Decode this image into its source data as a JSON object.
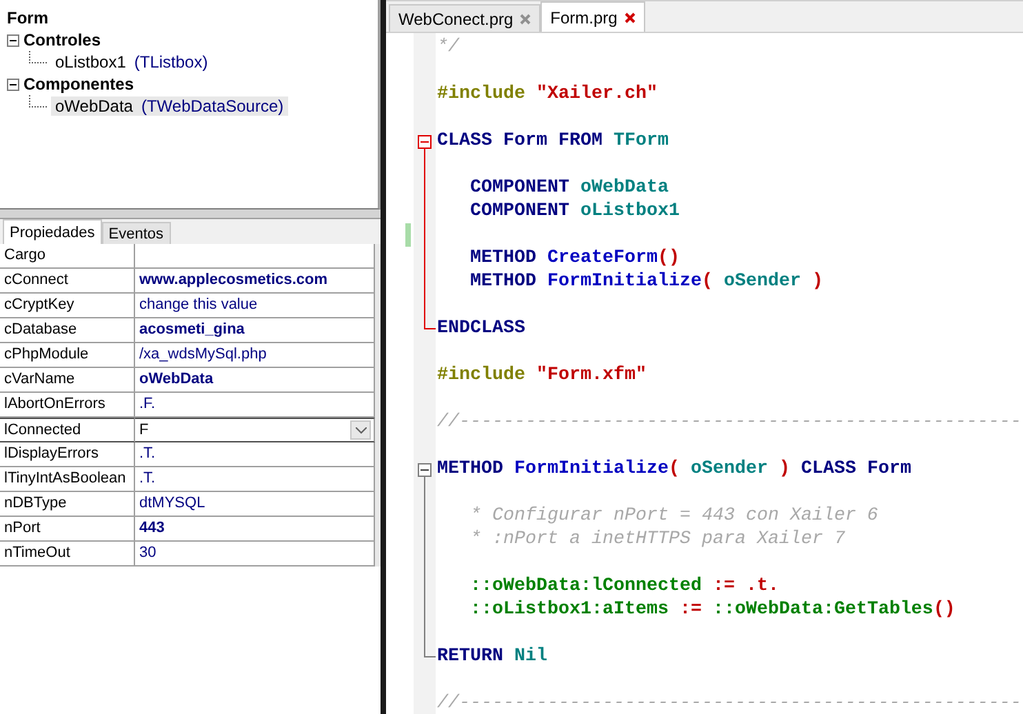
{
  "tree": {
    "root": "Form",
    "groups": [
      {
        "label": "Controles",
        "expanded": true,
        "children": [
          {
            "name": "oListbox1",
            "type": "(TListbox)",
            "selected": false
          }
        ]
      },
      {
        "label": "Componentes",
        "expanded": true,
        "children": [
          {
            "name": "oWebData",
            "type": "(TWebDataSource)",
            "selected": true
          }
        ]
      }
    ]
  },
  "inspector_tabs": [
    {
      "label": "Propiedades",
      "selected": true
    },
    {
      "label": "Eventos",
      "selected": false
    }
  ],
  "properties": [
    {
      "name": "Cargo",
      "bold": false,
      "kind": "text",
      "selected": false
    },
    {
      "name": "cConnect",
      "value": "www.applecosmetics.com",
      "bold": true,
      "kind": "text",
      "selected": false
    },
    {
      "name": "cCryptKey",
      "value": "change this value",
      "bold": false,
      "kind": "text",
      "selected": false
    },
    {
      "name": "cDatabase",
      "value": "acosmeti_gina",
      "bold": true,
      "kind": "text",
      "selected": false
    },
    {
      "name": "cPhpModule",
      "value": "/xa_wdsMySql.php",
      "bold": false,
      "kind": "text",
      "selected": false
    },
    {
      "name": "cVarName",
      "value": "oWebData",
      "bold": true,
      "kind": "text",
      "selected": false
    },
    {
      "name": "lAbortOnErrors",
      "value": ".F.",
      "bold": false,
      "kind": "text",
      "selected": false
    },
    {
      "name": "lConnected",
      "value": "F",
      "bold": false,
      "kind": "dropdown",
      "selected": true
    },
    {
      "name": "lDisplayErrors",
      "value": ".T.",
      "bold": false,
      "kind": "text",
      "selected": false
    },
    {
      "name": "lTinyIntAsBoolean",
      "value": ".T.",
      "bold": false,
      "kind": "text",
      "selected": false
    },
    {
      "name": "nDBType",
      "value": "dtMYSQL",
      "bold": false,
      "kind": "text",
      "selected": false
    },
    {
      "name": "nPort",
      "value": "443",
      "bold": true,
      "kind": "text",
      "selected": false
    },
    {
      "name": "nTimeOut",
      "value": "30",
      "bold": false,
      "kind": "text",
      "selected": false
    }
  ],
  "editor_tabs": [
    {
      "label": "WebConect.prg",
      "selected": false
    },
    {
      "label": "Form.prg",
      "selected": true
    }
  ],
  "code": [
    {
      "kind": "line",
      "tokens": [
        {
          "kind": "comment",
          "text": "*/"
        }
      ]
    },
    {
      "kind": "blank"
    },
    {
      "kind": "line",
      "tokens": [
        {
          "kind": "pre",
          "text": "#include "
        },
        {
          "kind": "str",
          "text": "\"Xailer.ch\""
        }
      ]
    },
    {
      "kind": "blank"
    },
    {
      "kind": "fold",
      "active": true,
      "lines": [
        {
          "kind": "line",
          "tokens": [
            {
              "kind": "kw",
              "text": "CLASS Form FROM "
            },
            {
              "kind": "id",
              "text": "TForm"
            }
          ]
        },
        {
          "kind": "blank"
        },
        {
          "kind": "line",
          "indented": true,
          "tokens": [
            {
              "kind": "kw",
              "text": "COMPONENT "
            },
            {
              "kind": "id",
              "text": "oWebData"
            }
          ]
        },
        {
          "kind": "line",
          "indented": true,
          "tokens": [
            {
              "kind": "kw",
              "text": "COMPONENT "
            },
            {
              "kind": "id",
              "text": "oListbox1"
            }
          ]
        },
        {
          "kind": "blank",
          "changed": true
        },
        {
          "kind": "line",
          "indented": true,
          "tokens": [
            {
              "kind": "kw",
              "text": "METHOD "
            },
            {
              "kind": "fn",
              "text": "CreateForm"
            },
            {
              "kind": "op",
              "text": "()"
            }
          ]
        },
        {
          "kind": "line",
          "indented": true,
          "tokens": [
            {
              "kind": "kw",
              "text": "METHOD "
            },
            {
              "kind": "fn",
              "text": "FormInitialize"
            },
            {
              "kind": "op",
              "text": "( "
            },
            {
              "kind": "id",
              "text": "oSender "
            },
            {
              "kind": "op",
              "text": ")"
            }
          ]
        },
        {
          "kind": "blank"
        },
        {
          "kind": "line",
          "tokens": [
            {
              "kind": "kw",
              "text": "ENDCLASS"
            }
          ]
        }
      ]
    },
    {
      "kind": "blank"
    },
    {
      "kind": "line",
      "tokens": [
        {
          "kind": "pre",
          "text": "#include "
        },
        {
          "kind": "str",
          "text": "\"Form.xfm\""
        }
      ]
    },
    {
      "kind": "blank"
    },
    {
      "kind": "line",
      "tokens": [
        {
          "kind": "comment",
          "text": "//---------------------------------------------------"
        }
      ]
    },
    {
      "kind": "blank"
    },
    {
      "kind": "fold",
      "active": false,
      "lines": [
        {
          "kind": "line",
          "tokens": [
            {
              "kind": "kw",
              "text": "METHOD "
            },
            {
              "kind": "fn",
              "text": "FormInitialize"
            },
            {
              "kind": "op",
              "text": "( "
            },
            {
              "kind": "id",
              "text": "oSender "
            },
            {
              "kind": "op",
              "text": ") "
            },
            {
              "kind": "kw",
              "text": "CLASS Form"
            }
          ]
        },
        {
          "kind": "blank"
        },
        {
          "kind": "line",
          "indented": true,
          "tokens": [
            {
              "kind": "comment",
              "text": "* Configurar nPort = 443 con Xailer 6"
            }
          ]
        },
        {
          "kind": "line",
          "indented": true,
          "tokens": [
            {
              "kind": "comment",
              "text": "* :nPort a inetHTTPS para Xailer 7"
            }
          ]
        },
        {
          "kind": "blank"
        },
        {
          "kind": "line",
          "indented": true,
          "tokens": [
            {
              "kind": "green",
              "text": "::oWebData:lConnected "
            },
            {
              "kind": "op",
              "text": ":= .t."
            }
          ]
        },
        {
          "kind": "line",
          "indented": true,
          "tokens": [
            {
              "kind": "green",
              "text": "::oListbox1:aItems "
            },
            {
              "kind": "op",
              "text": ":= "
            },
            {
              "kind": "green",
              "text": "::oWebData:GetTables"
            },
            {
              "kind": "op",
              "text": "()"
            }
          ]
        },
        {
          "kind": "blank"
        },
        {
          "kind": "line",
          "tokens": [
            {
              "kind": "kw",
              "text": "RETURN "
            },
            {
              "kind": "id",
              "text": "Nil"
            }
          ]
        }
      ]
    },
    {
      "kind": "blank"
    },
    {
      "kind": "line",
      "tokens": [
        {
          "kind": "comment",
          "text": "//---------------------------------------------------"
        }
      ]
    }
  ]
}
